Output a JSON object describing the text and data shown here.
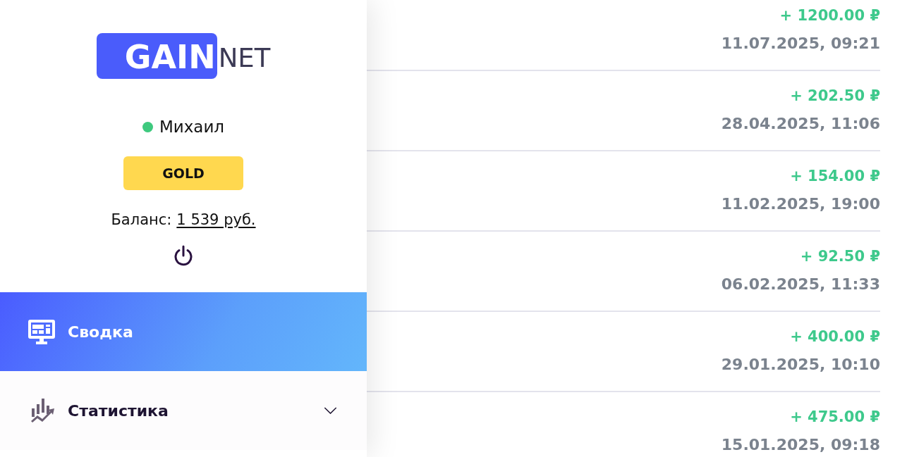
{
  "logo": {
    "highlighted": "GAIN",
    "rest": "NET"
  },
  "user": {
    "name": "Михаил",
    "online": true,
    "tier": "GOLD",
    "balance_label": "Баланс:",
    "balance": "1 539 руб."
  },
  "menu": [
    {
      "kind": "link",
      "label": "Сводка",
      "selected": true
    },
    {
      "kind": "group",
      "label": "Статистика",
      "selected": false,
      "expanded": false
    }
  ],
  "transactions": [
    {
      "amount": "+ 1200.00 ₽",
      "date": "11.07.2025, 09:21"
    },
    {
      "amount": "+ 202.50 ₽",
      "date": "28.04.2025, 11:06"
    },
    {
      "amount": "+ 154.00 ₽",
      "date": "11.02.2025, 19:00"
    },
    {
      "amount": "+ 92.50 ₽",
      "date": "06.02.2025, 11:33"
    },
    {
      "amount": "+ 400.00 ₽",
      "date": "29.01.2025, 10:10"
    },
    {
      "amount": "+ 475.00 ₽",
      "date": "15.01.2025, 09:18"
    }
  ]
}
